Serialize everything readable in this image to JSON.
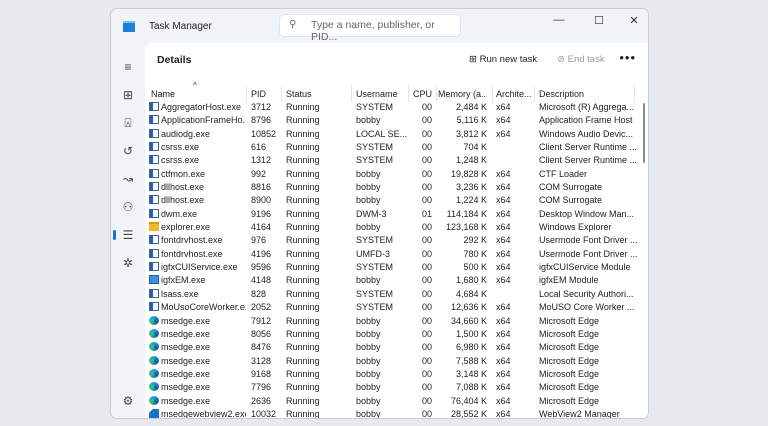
{
  "window": {
    "title": "Task Manager",
    "search_placeholder": "Type a name, publisher, or PID...",
    "minimize": "—",
    "maximize": "☐",
    "close": "✕"
  },
  "sidebar": {
    "items": [
      {
        "icon": "menu-icon",
        "glyph": "≡"
      },
      {
        "icon": "processes-icon",
        "glyph": "⊞"
      },
      {
        "icon": "performance-icon",
        "glyph": "⍓"
      },
      {
        "icon": "app-history-icon",
        "glyph": "↺"
      },
      {
        "icon": "startup-apps-icon",
        "glyph": "↝"
      },
      {
        "icon": "users-icon",
        "glyph": "⚇"
      },
      {
        "icon": "details-icon",
        "glyph": "☰",
        "active": true
      },
      {
        "icon": "services-icon",
        "glyph": "✲"
      }
    ],
    "settings": "⚙"
  },
  "page": {
    "title": "Details",
    "run_new_task": "Run new task",
    "end_task": "End task",
    "more": "•••"
  },
  "columns": [
    "Name",
    "PID",
    "Status",
    "Username",
    "CPU",
    "Memory (a...",
    "Archite...",
    "Description"
  ],
  "rows": [
    [
      "AggregatorHost.exe",
      "3712",
      "Running",
      "SYSTEM",
      "00",
      "2,484 K",
      "x64",
      "Microsoft (R) Aggrega...",
      "app"
    ],
    [
      "ApplicationFrameHo...",
      "8796",
      "Running",
      "bobby",
      "00",
      "5,116 K",
      "x64",
      "Application Frame Host",
      "app"
    ],
    [
      "audiodg.exe",
      "10852",
      "Running",
      "LOCAL SE...",
      "00",
      "3,812 K",
      "x64",
      "Windows Audio Devic...",
      "app"
    ],
    [
      "csrss.exe",
      "616",
      "Running",
      "SYSTEM",
      "00",
      "704 K",
      "",
      "Client Server Runtime ...",
      "app"
    ],
    [
      "csrss.exe",
      "1312",
      "Running",
      "SYSTEM",
      "00",
      "1,248 K",
      "",
      "Client Server Runtime ...",
      "app"
    ],
    [
      "ctfmon.exe",
      "992",
      "Running",
      "bobby",
      "00",
      "19,828 K",
      "x64",
      "CTF Loader",
      "app"
    ],
    [
      "dllhost.exe",
      "8816",
      "Running",
      "bobby",
      "00",
      "3,236 K",
      "x64",
      "COM Surrogate",
      "app"
    ],
    [
      "dllhost.exe",
      "8900",
      "Running",
      "bobby",
      "00",
      "1,224 K",
      "x64",
      "COM Surrogate",
      "app"
    ],
    [
      "dwm.exe",
      "9196",
      "Running",
      "DWM-3",
      "01",
      "114,184 K",
      "x64",
      "Desktop Window Man...",
      "app"
    ],
    [
      "explorer.exe",
      "4164",
      "Running",
      "bobby",
      "00",
      "123,168 K",
      "x64",
      "Windows Explorer",
      "folder"
    ],
    [
      "fontdrvhost.exe",
      "976",
      "Running",
      "SYSTEM",
      "00",
      "292 K",
      "x64",
      "Usermode Font Driver ...",
      "app"
    ],
    [
      "fontdrvhost.exe",
      "4196",
      "Running",
      "UMFD-3",
      "00",
      "780 K",
      "x64",
      "Usermode Font Driver ...",
      "app"
    ],
    [
      "igfxCUIService.exe",
      "9596",
      "Running",
      "SYSTEM",
      "00",
      "500 K",
      "x64",
      "igfxCUIService Module",
      "app"
    ],
    [
      "igfxEM.exe",
      "4148",
      "Running",
      "bobby",
      "00",
      "1,680 K",
      "x64",
      "igfxEM Module",
      "igfx"
    ],
    [
      "lsass.exe",
      "828",
      "Running",
      "SYSTEM",
      "00",
      "4,684 K",
      "",
      "Local Security Authori...",
      "app"
    ],
    [
      "MoUsoCoreWorker.e...",
      "2052",
      "Running",
      "SYSTEM",
      "00",
      "12,636 K",
      "x64",
      "MoUSO Core Worker ...",
      "app"
    ],
    [
      "msedge.exe",
      "7912",
      "Running",
      "bobby",
      "00",
      "34,660 K",
      "x64",
      "Microsoft Edge",
      "edge"
    ],
    [
      "msedge.exe",
      "8056",
      "Running",
      "bobby",
      "00",
      "1,500 K",
      "x64",
      "Microsoft Edge",
      "edge"
    ],
    [
      "msedge.exe",
      "8476",
      "Running",
      "bobby",
      "00",
      "6,980 K",
      "x64",
      "Microsoft Edge",
      "edge"
    ],
    [
      "msedge.exe",
      "3128",
      "Running",
      "bobby",
      "00",
      "7,588 K",
      "x64",
      "Microsoft Edge",
      "edge"
    ],
    [
      "msedge.exe",
      "9168",
      "Running",
      "bobby",
      "00",
      "3,148 K",
      "x64",
      "Microsoft Edge",
      "edge"
    ],
    [
      "msedge.exe",
      "7796",
      "Running",
      "bobby",
      "00",
      "7,088 K",
      "x64",
      "Microsoft Edge",
      "edge"
    ],
    [
      "msedge.exe",
      "2636",
      "Running",
      "bobby",
      "00",
      "76,404 K",
      "x64",
      "Microsoft Edge",
      "edge"
    ],
    [
      "msedgewebview2.exe",
      "10032",
      "Running",
      "bobby",
      "00",
      "28,552 K",
      "x64",
      "WebView2 Manager",
      "wv"
    ]
  ],
  "colors": {
    "accent": "#1a6fd0"
  }
}
